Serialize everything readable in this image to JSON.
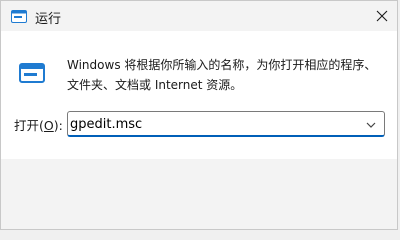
{
  "window": {
    "title": "运行",
    "close_icon": "close-icon",
    "app_icon": "run-app-icon"
  },
  "main": {
    "description": "Windows 将根据你所输入的名称，为你打开相应的程序、文件夹、文档或 Internet 资源。",
    "open_label_prefix": "打开(",
    "open_label_accel": "O",
    "open_label_suffix": "):",
    "command_value": "gpedit.msc",
    "dropdown_icon": "chevron-down-icon"
  },
  "colors": {
    "accent": "#005fb8",
    "icon_blue": "#1f7bd1",
    "background": "#f3f3f3",
    "content_bg": "#ffffff"
  }
}
